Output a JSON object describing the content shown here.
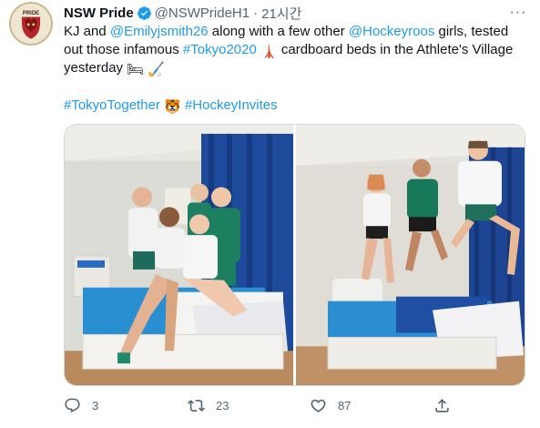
{
  "colors": {
    "link": "#1d9bf0",
    "verified": "#1d9bf0",
    "secondary_text": "#536471",
    "primary_text": "#0f1419"
  },
  "account": {
    "display_name": "NSW Pride",
    "handle": "@NSWPrideH1",
    "separator": "·",
    "time": "21시간",
    "avatar_text": "PRIDE",
    "avatar_icon": "pride-logo",
    "verified_icon": "verified-badge-icon",
    "more_icon": "more-dots-icon",
    "more_label": "···"
  },
  "tweet": {
    "l1_a": "KJ and ",
    "l1_mention1": "@Emilyjsmith26",
    "l1_b": " along with a few other ",
    "l1_mention2": "@Hockeyroos",
    "l1_c": " girls, tested",
    "l2_a": "out those infamous ",
    "l2_hashtag": "#Tokyo2020",
    "l2_emoji": "🗼",
    "l2_b": " cardboard beds in the Athlete's Village",
    "l3_a": "yesterday ",
    "l3_emoji": "🛏 🏑",
    "hashtag1": "#TokyoTogether",
    "hashtag_emoji": "🐯",
    "hashtag2": "#HockeyInvites"
  },
  "media": {
    "photo_left": "group-on-bed-photo",
    "photo_right": "jumping-on-bed-photo"
  },
  "actions": {
    "reply": {
      "icon": "reply-icon",
      "count": "3"
    },
    "retweet": {
      "icon": "retweet-icon",
      "count": "23"
    },
    "like": {
      "icon": "heart-icon",
      "count": "87"
    },
    "share": {
      "icon": "share-icon"
    }
  }
}
